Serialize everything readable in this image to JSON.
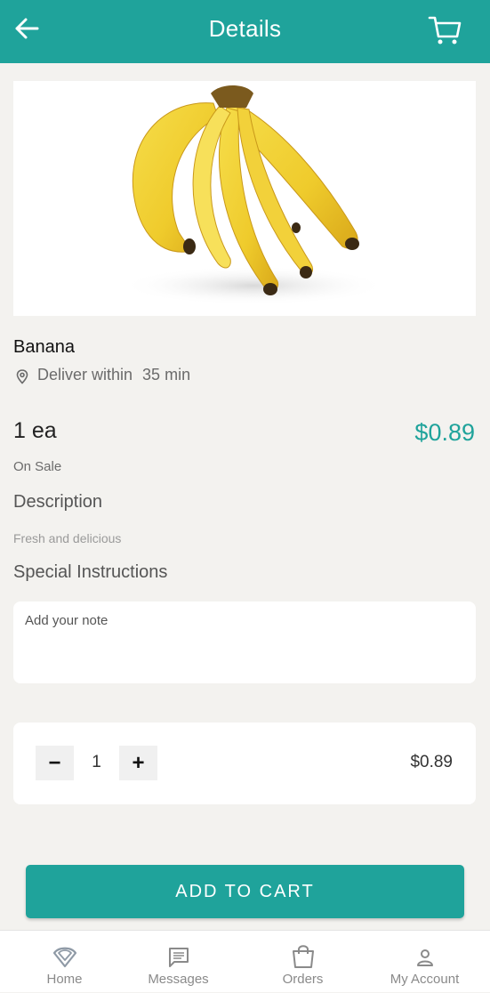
{
  "header": {
    "title": "Details",
    "back_icon": "arrow-left-icon",
    "cart_icon": "cart-icon",
    "color": "#1fa39b"
  },
  "product": {
    "image": "banana-bunch",
    "name": "Banana",
    "deliver_label": "Deliver within",
    "deliver_time": "35 min",
    "unit": "1 ea",
    "price": "$0.89",
    "sale_status": "On Sale",
    "description_heading": "Description",
    "description": "Fresh and delicious"
  },
  "instructions": {
    "heading": "Special Instructions",
    "placeholder": "Add your note",
    "value": ""
  },
  "quantity": {
    "minus_label": "−",
    "value": "1",
    "plus_label": "+",
    "total": "$0.89"
  },
  "actions": {
    "add_to_cart": "ADD TO CART"
  },
  "tabbar": {
    "items": [
      {
        "label": "Home",
        "icon": "home-logo-icon"
      },
      {
        "label": "Messages",
        "icon": "message-icon"
      },
      {
        "label": "Orders",
        "icon": "shopping-bag-icon"
      },
      {
        "label": "My Account",
        "icon": "person-icon"
      }
    ]
  }
}
